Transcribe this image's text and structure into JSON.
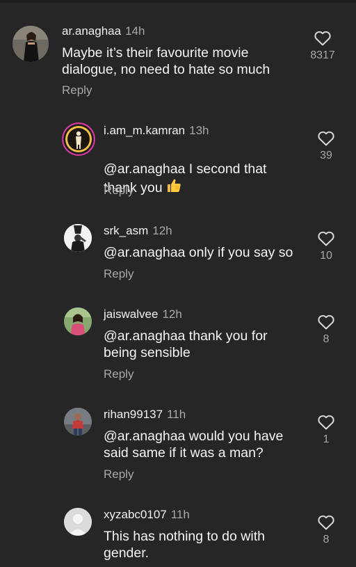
{
  "comments": [
    {
      "username": "ar.anaghaa",
      "time": "14h",
      "text": "Maybe it’s their favourite movie\ndialogue, no need to hate so much",
      "reply_label": "Reply",
      "like_count": "8317",
      "avatar": "woman-in-black-dress-avatar"
    },
    {
      "username": "i.am_m.kamran",
      "time": "13h",
      "text": "@ar.anaghaa I second that\nthank you",
      "emoji": "thumbs-up",
      "reply_label": "Reply",
      "like_count": "39",
      "avatar": "silhouette-ring-avatar"
    },
    {
      "username": "srk_asm",
      "time": "12h",
      "text": "@ar.anaghaa only if you say so",
      "reply_label": "Reply",
      "like_count": "10",
      "avatar": "black-white-figure-avatar"
    },
    {
      "username": "jaiswalvee",
      "time": "12h",
      "text": "@ar.anaghaa thank you for\nbeing sensible",
      "reply_label": "Reply",
      "like_count": "8",
      "avatar": "woman-outdoors-avatar"
    },
    {
      "username": "rihan99137",
      "time": "11h",
      "text": "@ar.anaghaa would you have\nsaid same if it was a man?",
      "reply_label": "Reply",
      "like_count": "1",
      "avatar": "man-standing-avatar"
    },
    {
      "username": "xyzabc0107",
      "time": "11h",
      "text": "This has nothing to do with\ngender.",
      "like_count": "8",
      "avatar": "default-gray-avatar"
    }
  ],
  "colors": {
    "background": "#262626",
    "text": "#f5f5f5",
    "secondary": "#a8a8a8"
  }
}
